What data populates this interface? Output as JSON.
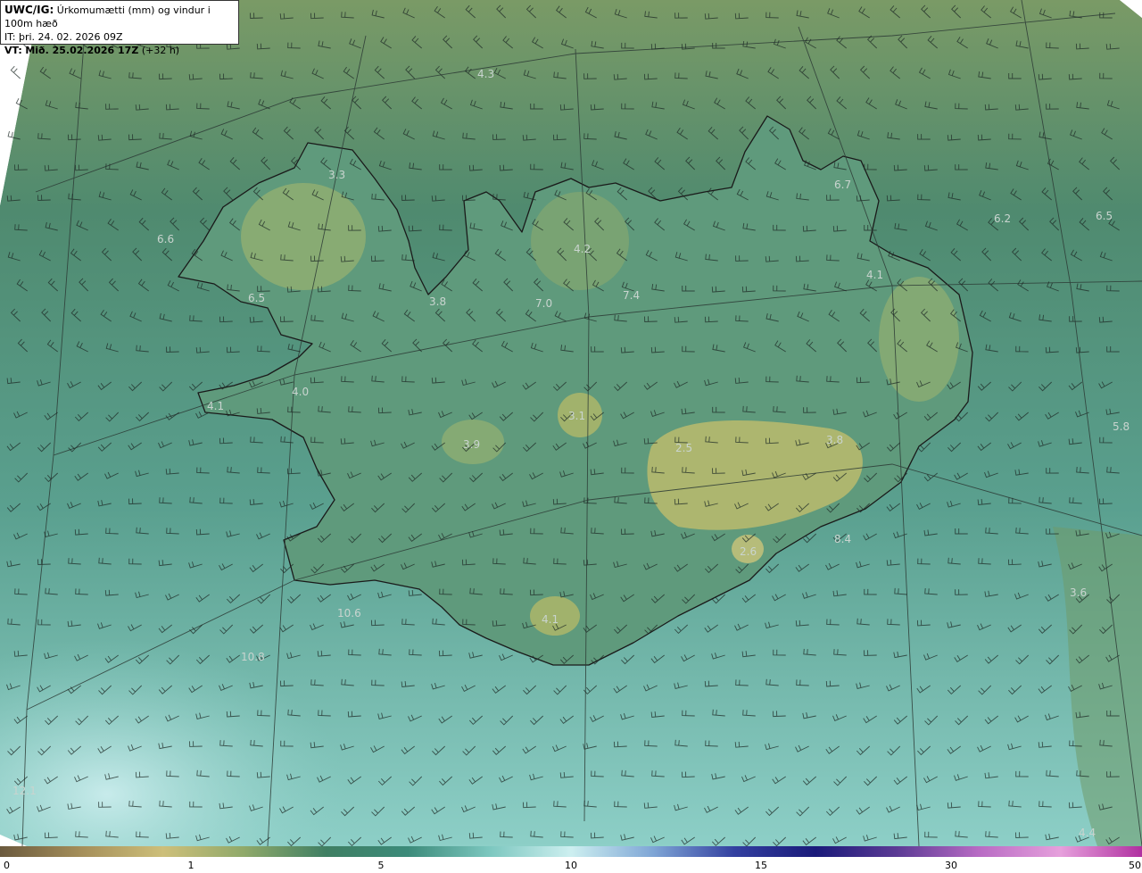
{
  "header": {
    "model": "UWC/IG:",
    "title": "Úrkomumætti (mm) og vindur i 100m hæð",
    "it_line": "IT: þri. 24. 02. 2026 09Z",
    "vt_prefix": "VT:",
    "vt_bold": "Mið. 25.02.2026 17Z",
    "vt_offset": "(+32 h)"
  },
  "colorbar": {
    "ticks": [
      "0",
      "1",
      "5",
      "10",
      "15",
      "30",
      "50"
    ],
    "colors": [
      "#6b5a3e",
      "#a58f5a",
      "#cdbf7a",
      "#8fa96a",
      "#3f7f63",
      "#3c8b7a",
      "#7cc7bf",
      "#cdeff0",
      "#7fa6d6",
      "#3340a0",
      "#1a1a7a",
      "#5c3b95",
      "#b86bc4",
      "#e6a0dc",
      "#b030a0"
    ]
  },
  "map": {
    "ocean_color": "#5f9f92",
    "land_color": "#6fa07c",
    "highland_color": "#a8b56a",
    "outside_color": "#ffffff",
    "values": [
      "4.3",
      "3.3",
      "6.6",
      "6.5",
      "3.8",
      "7.0",
      "4.2",
      "7.4",
      "6.7",
      "6.2",
      "6.5",
      "4.1",
      "4.0",
      "4.1",
      "3.1",
      "3.9",
      "2.5",
      "3.8",
      "5.8",
      "8.4",
      "2.6",
      "3.6",
      "10.6",
      "10.8",
      "4.1",
      "4.4",
      "12.1"
    ]
  }
}
